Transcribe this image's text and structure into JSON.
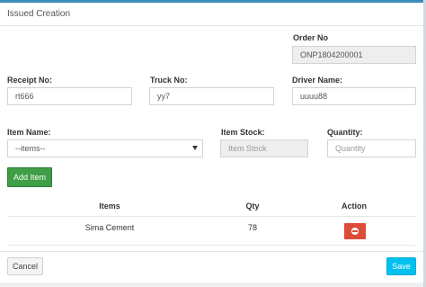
{
  "panel": {
    "title": "Issued Creation"
  },
  "form": {
    "order_no": {
      "label": "Order No",
      "value": "ONP1804200001"
    },
    "receipt_no": {
      "label": "Receipt No:",
      "value": "rt666"
    },
    "truck_no": {
      "label": "Truck No:",
      "value": "yy7"
    },
    "driver_name": {
      "label": "Driver Name:",
      "value": "uuuu88"
    },
    "item_name": {
      "label": "Item Name:",
      "selected": "--items--"
    },
    "item_stock": {
      "label": "Item Stock:",
      "placeholder": "Item Stock"
    },
    "quantity": {
      "label": "Quantity:",
      "placeholder": "Quantity"
    }
  },
  "buttons": {
    "add_item": "Add Item",
    "cancel": "Cancel",
    "save": "Save"
  },
  "table": {
    "headers": [
      "Items",
      "Qty",
      "Action"
    ],
    "rows": [
      {
        "item": "Sima Cement",
        "qty": "78"
      }
    ]
  },
  "colors": {
    "accent": "#3c8dbc",
    "add": "#3f9e46",
    "delete": "#dd4b39",
    "save": "#00c0ef"
  }
}
